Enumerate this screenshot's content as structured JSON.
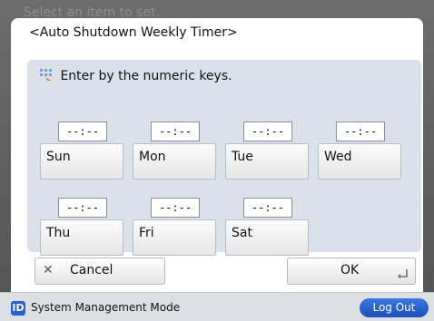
{
  "backdrop": {
    "text": "Select an item to set."
  },
  "dialog": {
    "title": "<Auto Shutdown Weekly Timer>",
    "instruction": "Enter by the numeric keys.",
    "days": [
      {
        "label": "Sun",
        "time": "--:--"
      },
      {
        "label": "Mon",
        "time": "--:--"
      },
      {
        "label": "Tue",
        "time": "--:--"
      },
      {
        "label": "Wed",
        "time": "--:--"
      },
      {
        "label": "Thu",
        "time": "--:--"
      },
      {
        "label": "Fri",
        "time": "--:--"
      },
      {
        "label": "Sat",
        "time": "--:--"
      }
    ],
    "cancel_label": "Cancel",
    "ok_label": "OK"
  },
  "status": {
    "mode_icon_text": "ID",
    "mode_text": "System Management Mode",
    "logout_label": "Log Out"
  }
}
